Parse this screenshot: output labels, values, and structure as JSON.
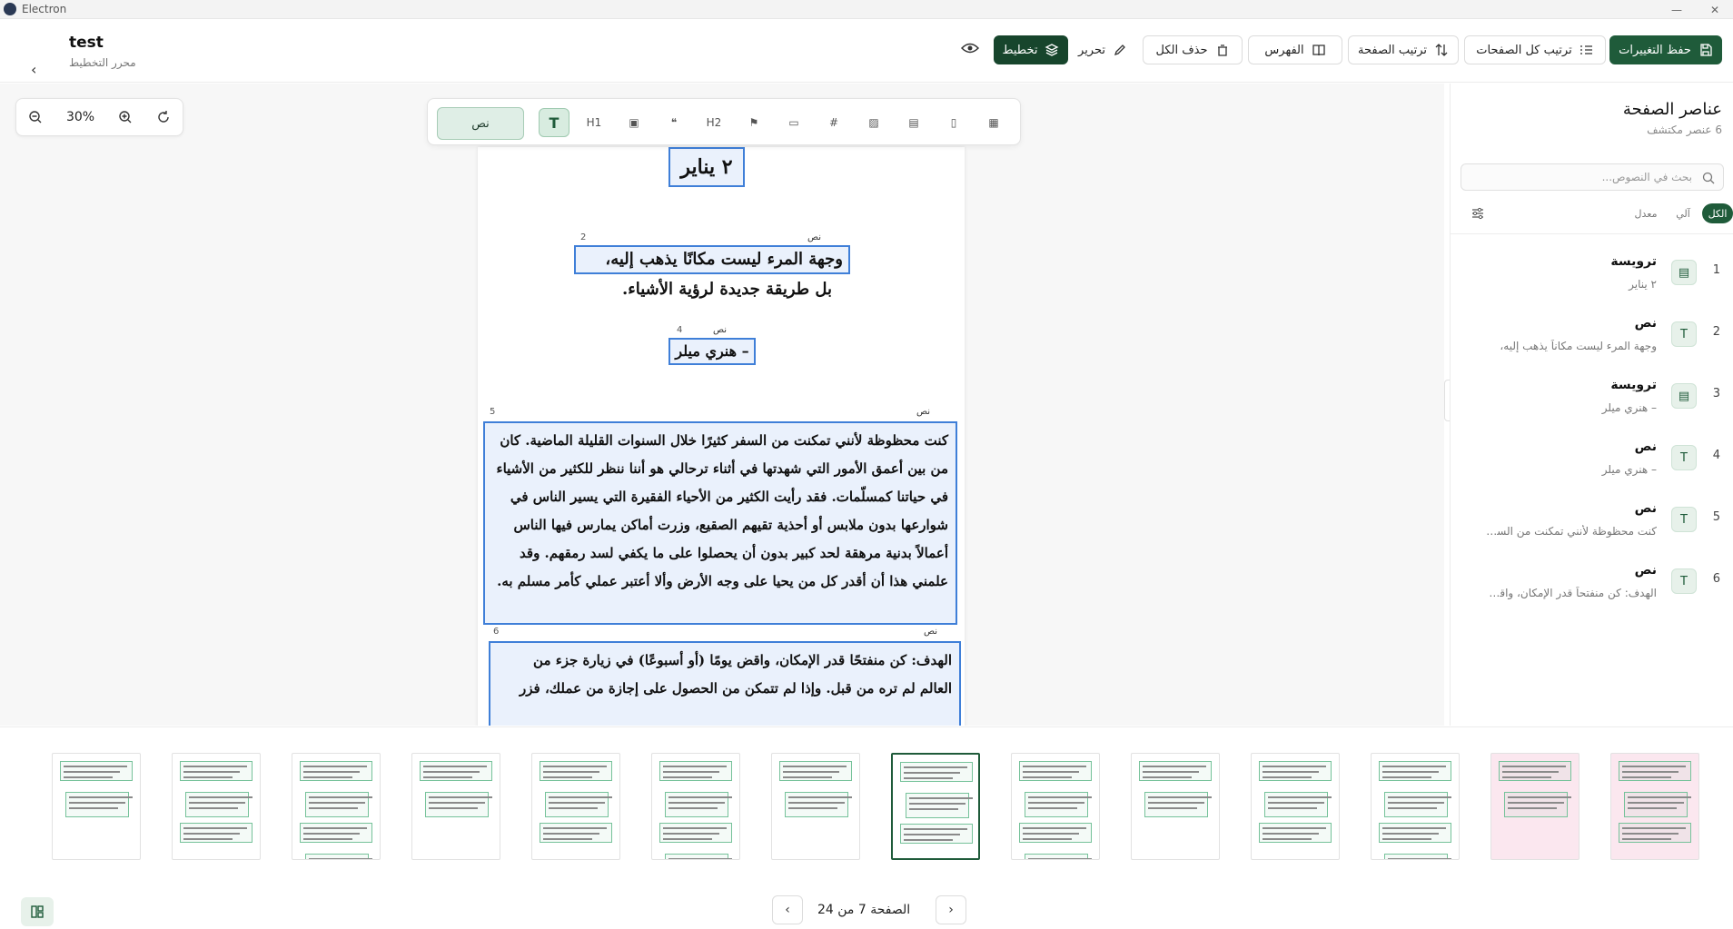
{
  "window": {
    "title": "Electron"
  },
  "header": {
    "doc_title": "test",
    "doc_subtitle": "محرر التخطيط"
  },
  "toolbar": {
    "save": "حفظ التغييرات",
    "reorder_all": "ترتيب كل الصفحات",
    "reorder_page": "ترتيب الصفحة",
    "index": "الفهرس",
    "delete_all": "حذف الكل",
    "edit": "تحرير",
    "layout": "تخطيط"
  },
  "zoom": {
    "level": "30%"
  },
  "tools": {
    "selected_type": "نص",
    "h1": "H1",
    "h2": "H2"
  },
  "page_blocks": {
    "title": "٢ يناير",
    "quote_line1": "وجهة المرء ليست مكانًا يذهب إليه،",
    "quote_line2": "بل طريقة جديدة لرؤية الأشياء.",
    "author": "– هنري ميلر",
    "para": "كنت محظوظة لأنني تمكنت من السفر كثيرًا خلال السنوات القليلة الماضية. كان من بين أعمق الأمور التي شهدتها في أثناء ترحالي هو أننا ننظر للكثير من الأشياء في حياتنا كمسلّمات. فقد رأيت الكثير من الأحياء الفقيرة التي يسير الناس في شوارعها بدون ملابس أو أحذية تقيهم الصقيع، وزرت أماكن يمارس فيها الناس أعمالاً بدنية مرهقة لحد كبير بدون أن يحصلوا على ما يكفي لسد رمقهم. وقد علمني هذا أن أقدر كل من يحيا على وجه الأرض وألا أعتبر عملي كأمر مسلم به.",
    "goal": "الهدف: كن منفتحًا قدر الإمكان، واقض يومًا (أو أسبوعًا) في زيارة جزء من العالم لم تره من قبل. وإذا لم تتمكن من الحصول على إجازة من عملك، فزر",
    "tag_text": "نص",
    "num2": "2",
    "num4": "4",
    "num5": "5",
    "num6": "6"
  },
  "right_panel": {
    "title": "عناصر الصفحة",
    "subtitle": "6 عنصر مكتشف",
    "search_placeholder": "بحث في النصوص...",
    "filters": [
      "الكل",
      "آلي",
      "معدل"
    ],
    "items": [
      {
        "num": "1",
        "type": "ترويسة",
        "text": "٢ يناير",
        "icon": "heading-icon"
      },
      {
        "num": "2",
        "type": "نص",
        "text": "وجهة المرء ليست مكاناً يذهب إليه،",
        "icon": "text-icon"
      },
      {
        "num": "3",
        "type": "ترويسة",
        "text": "– هنري ميلر",
        "icon": "heading-icon"
      },
      {
        "num": "4",
        "type": "نص",
        "text": "– هنري ميلر",
        "icon": "text-icon"
      },
      {
        "num": "5",
        "type": "نص",
        "text": "كنت محظوظة لأنني تمكنت من السفر...",
        "icon": "text-icon"
      },
      {
        "num": "6",
        "type": "نص",
        "text": "الهدف: كن منفتحاً قدر الإمكان، واقض ...",
        "icon": "text-icon"
      }
    ]
  },
  "pager": {
    "info": "الصفحة 7 من 24"
  },
  "colors": {
    "accent": "#1f5b3a",
    "selection": "#3f7fd8"
  }
}
